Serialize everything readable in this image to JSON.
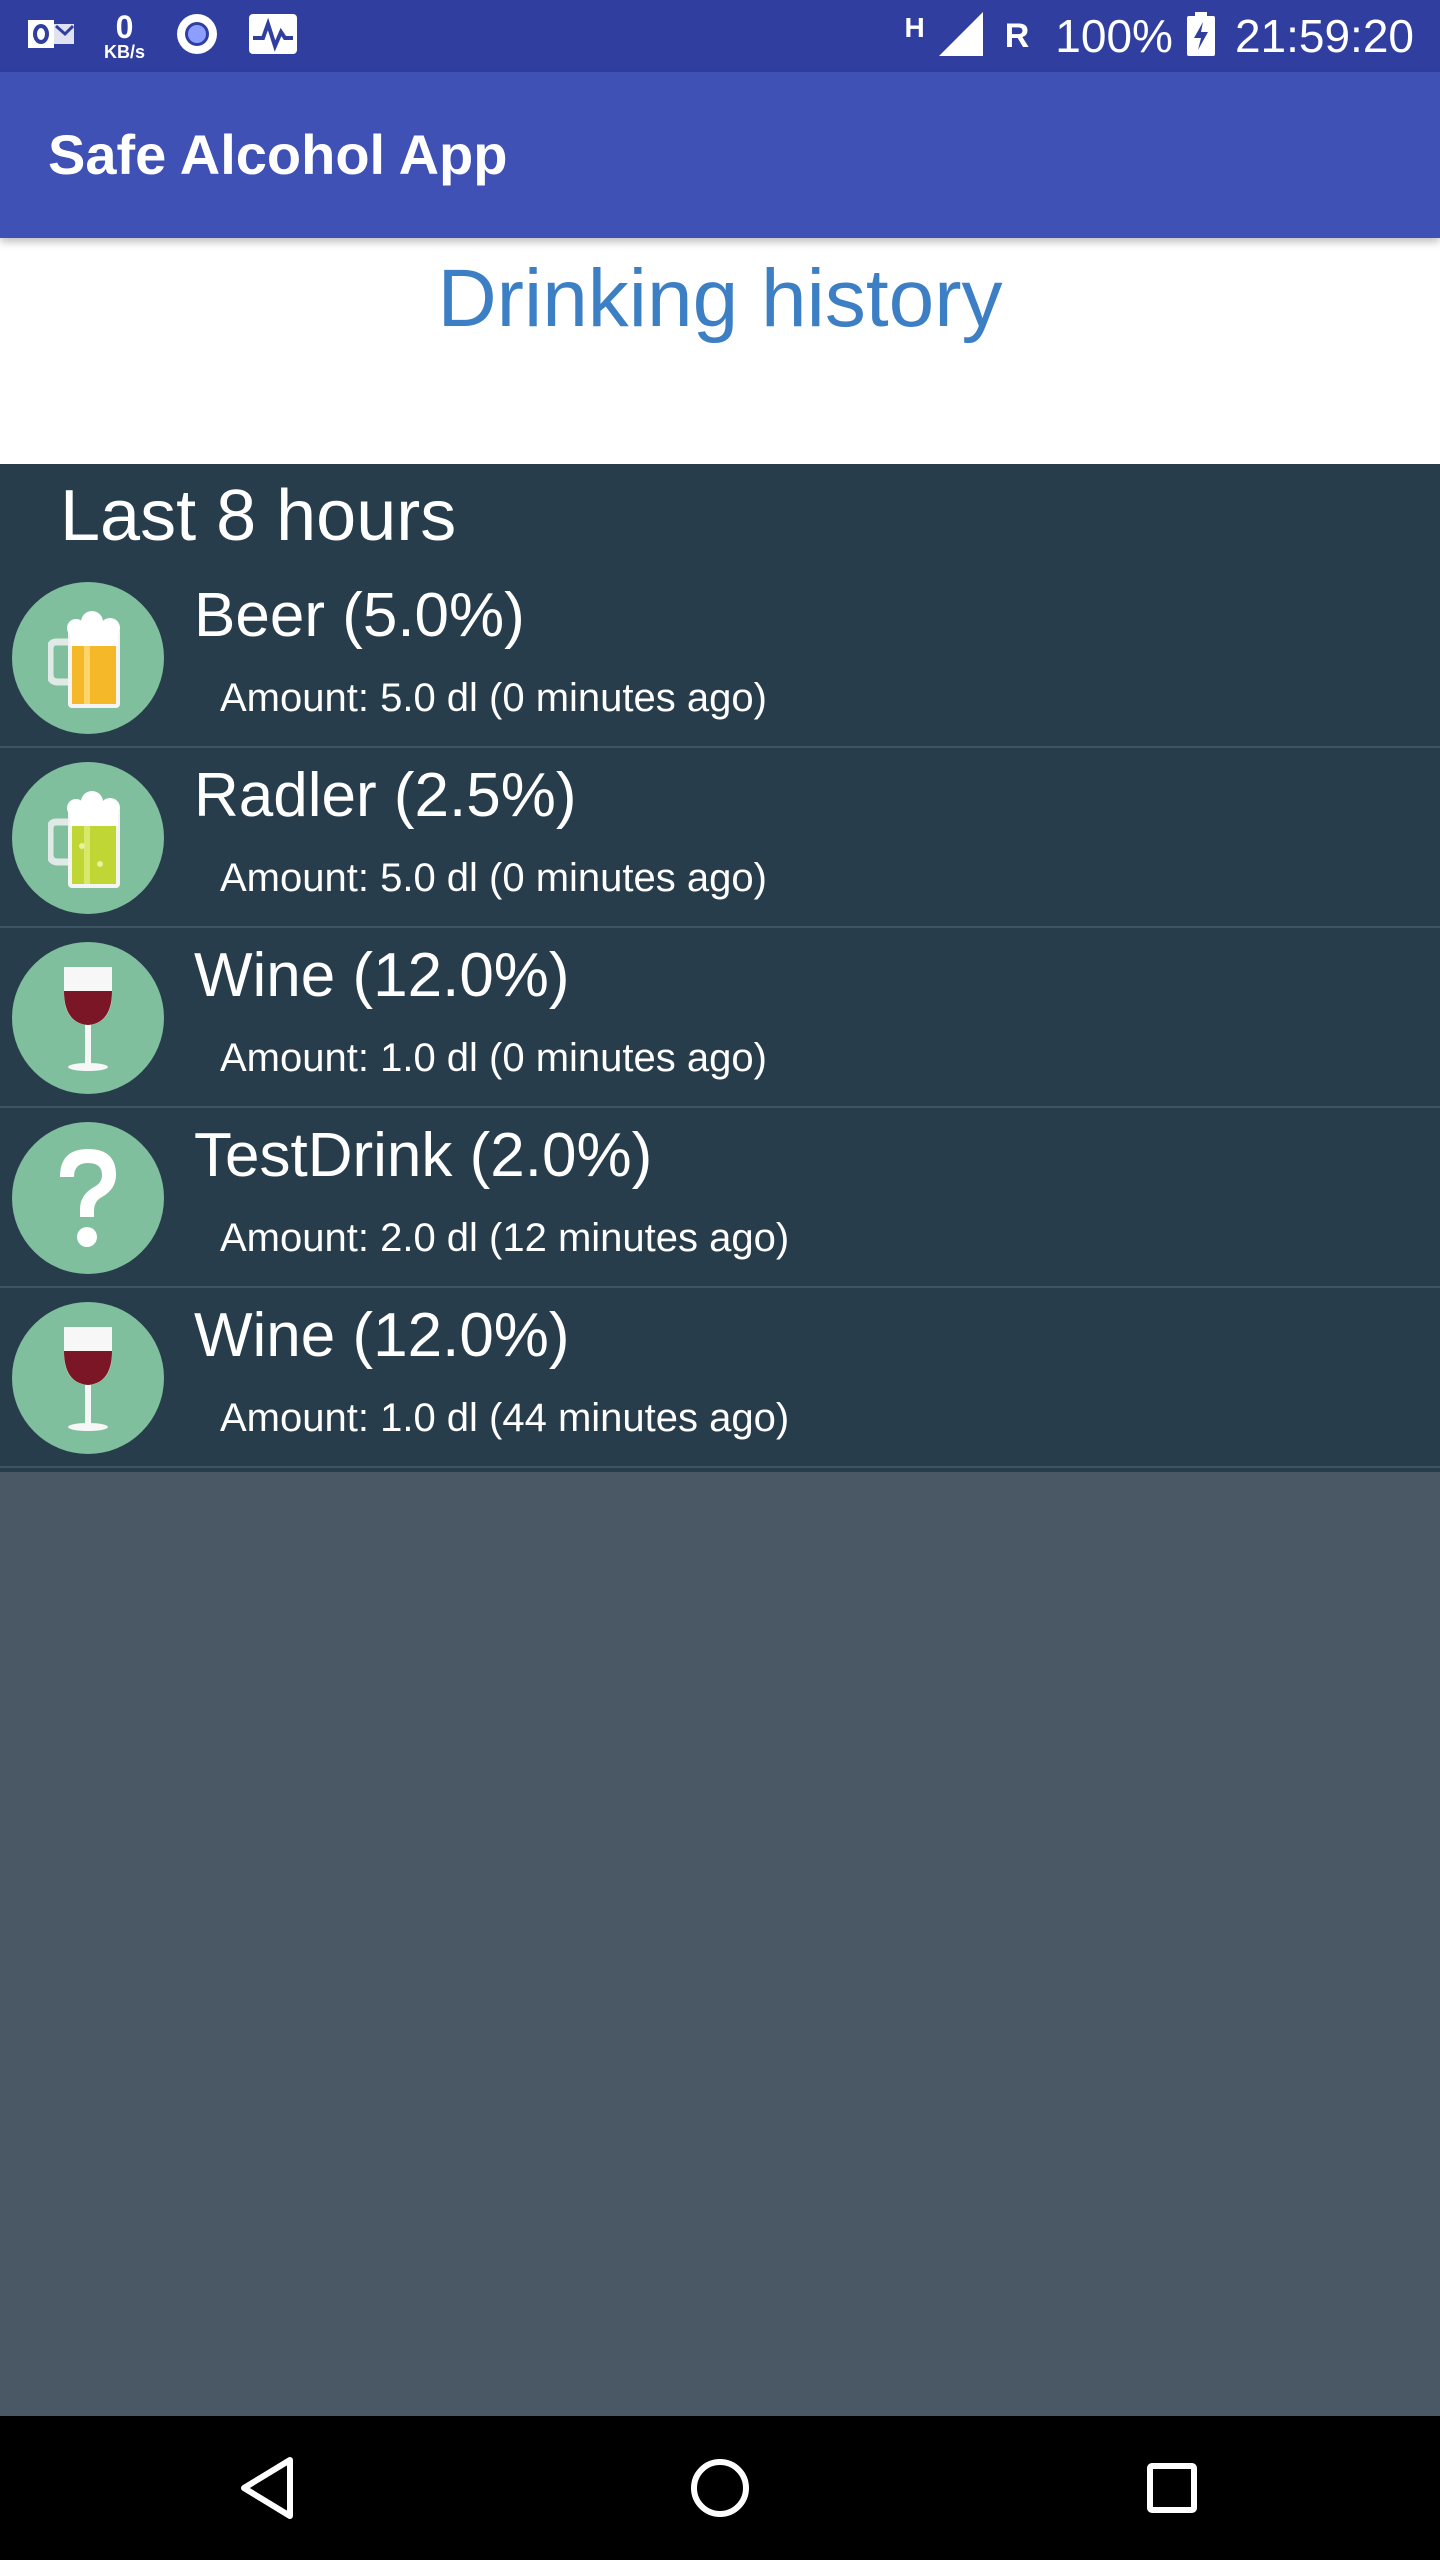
{
  "status_bar": {
    "net_speed_value": "0",
    "net_speed_unit": "KB/s",
    "network_type": "H",
    "roaming": "R",
    "battery": "100%",
    "time": "21:59:20"
  },
  "app_bar": {
    "title": "Safe Alcohol App"
  },
  "page": {
    "title": "Drinking history"
  },
  "section": {
    "title": "Last 8 hours"
  },
  "drinks": [
    {
      "name": "Beer (5.0%)",
      "detail": "Amount: 5.0 dl  (0 minutes ago)",
      "icon": "beer-mug-icon"
    },
    {
      "name": "Radler (2.5%)",
      "detail": "Amount: 5.0 dl  (0 minutes ago)",
      "icon": "radler-mug-icon"
    },
    {
      "name": "Wine (12.0%)",
      "detail": "Amount: 1.0 dl  (0 minutes ago)",
      "icon": "wine-glass-icon"
    },
    {
      "name": "TestDrink (2.0%)",
      "detail": "Amount: 2.0 dl  (12 minutes ago)",
      "icon": "question-mark-icon"
    },
    {
      "name": "Wine (12.0%)",
      "detail": "Amount: 1.0 dl  (44 minutes ago)",
      "icon": "wine-glass-icon"
    }
  ],
  "colors": {
    "status_bar": "#303f9f",
    "app_bar": "#3f51b5",
    "title_blue": "#3d7fc4",
    "list_bg": "#283d4c",
    "empty_bg": "#4a5866",
    "avatar": "#7fbf9d"
  }
}
